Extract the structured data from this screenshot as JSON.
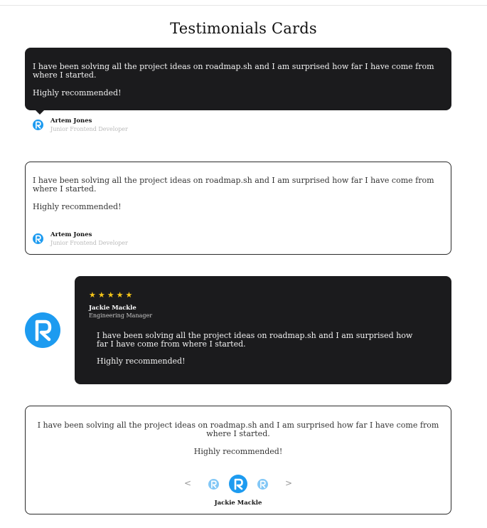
{
  "page": {
    "title": "Testimonials Cards"
  },
  "quote": {
    "line1": "I have been solving all the project ideas on roadmap.sh and I am surprised how far I have come from where I started.",
    "line2": "Highly recommended!"
  },
  "card1": {
    "author_name": "Artem Jones",
    "author_role": "Junior Frontend Developer"
  },
  "card2": {
    "author_name": "Artem Jones",
    "author_role": "Junior Frontend Developer"
  },
  "card3": {
    "stars": 5,
    "star_glyph": "★",
    "author_name": "Jackie Mackle",
    "author_role": "Engineering Manager"
  },
  "card4": {
    "author_name": "Jackie Mackle",
    "prev_arrow": "<",
    "next_arrow": ">"
  },
  "colors": {
    "dark_card": "#1b1b1d",
    "accent": "#1d9bf0",
    "star": "#f5c518"
  },
  "icons": {
    "avatar": "roadmap-logo-icon"
  }
}
